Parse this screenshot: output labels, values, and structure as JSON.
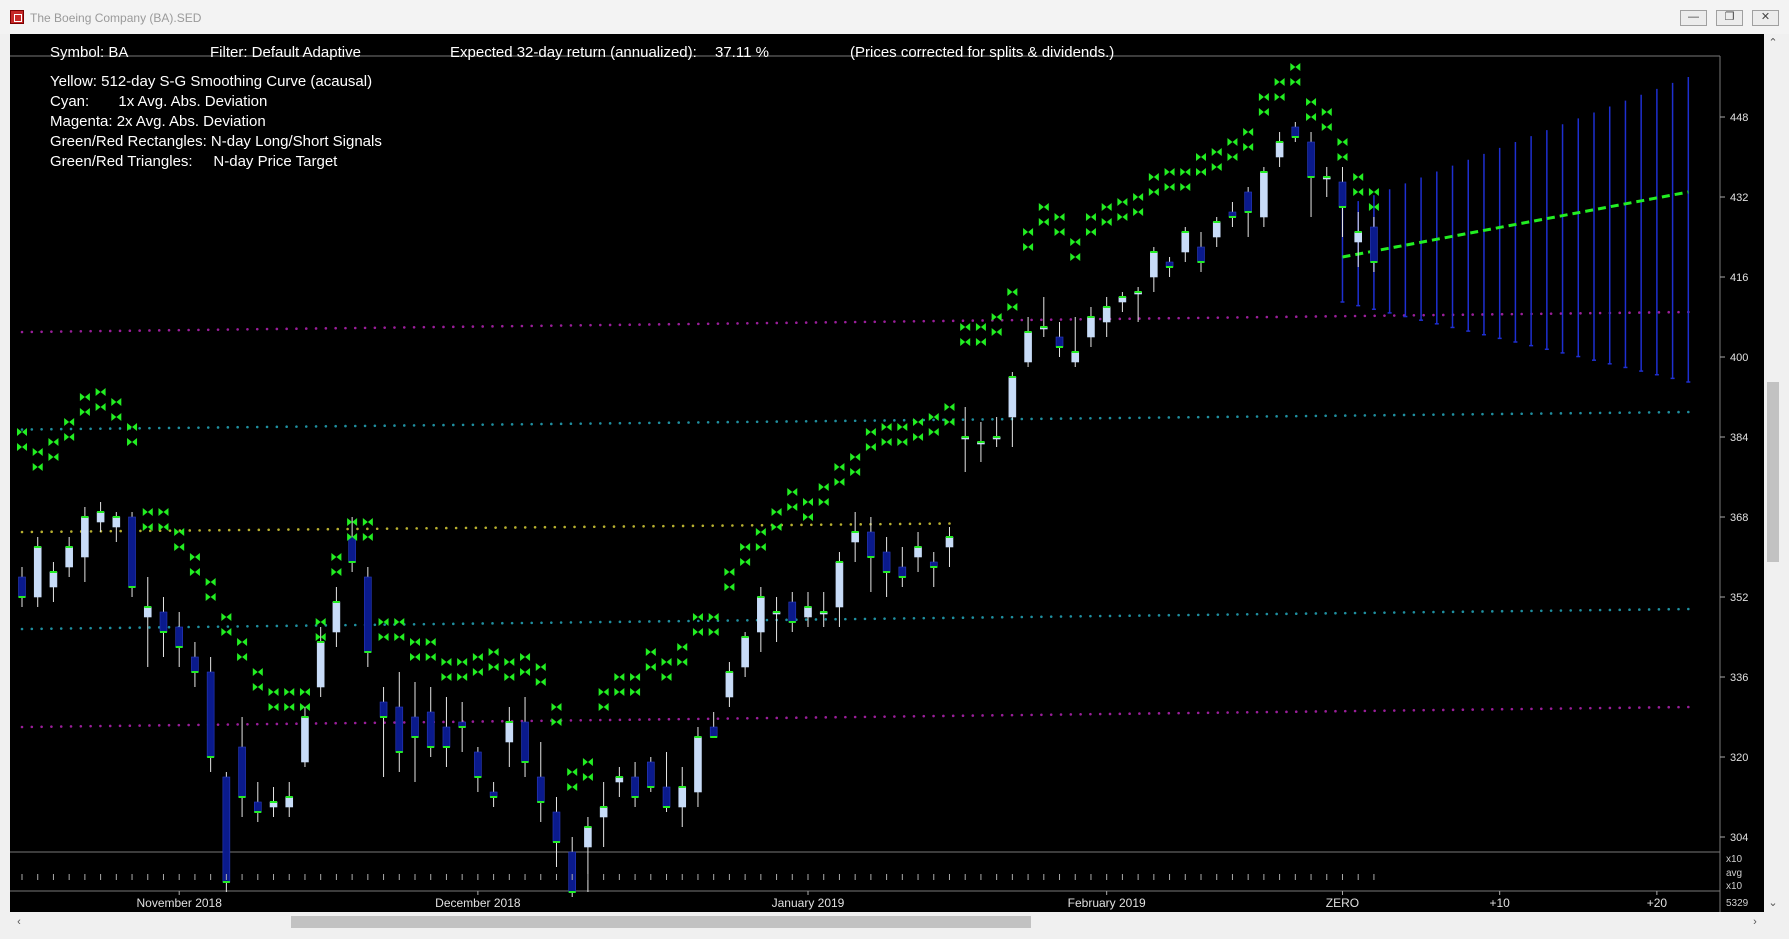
{
  "window": {
    "title": "The Boeing Company (BA).SED",
    "buttons": [
      "minimize",
      "restore",
      "close"
    ]
  },
  "header": {
    "symbol": "Symbol: BA",
    "filter": "Filter: Default Adaptive",
    "expected_label": "Expected 32-day return (annualized):",
    "expected_value": "37.11 %",
    "note": "(Prices corrected for splits & dividends.)"
  },
  "legend": [
    "Yellow: 512-day S-G Smoothing Curve (acausal)",
    "Cyan:       1x Avg. Abs. Deviation",
    "Magenta: 2x Avg. Abs. Deviation",
    "Green/Red Rectangles: N-day Long/Short Signals",
    "Green/Red Triangles:     N-day Price Target"
  ],
  "lower_panel": {
    "labels": [
      "x10",
      "avg",
      "x10"
    ],
    "counter": "5329"
  },
  "colors": {
    "background": "#000000",
    "candle_up": "#c8dcf8",
    "candle_down": "#0a1a8c",
    "signal": "#22ee22",
    "smooth_curve": "#b8b030",
    "dev1": "#1f8fa0",
    "dev2": "#9a1e9a",
    "forecast_band": "#1e2fd0",
    "forecast_line": "#22ee22"
  },
  "chart_data": {
    "type": "candlestick",
    "ylim": [
      292,
      454
    ],
    "y_ticks": [
      448,
      432,
      416,
      400,
      384,
      368,
      352,
      336,
      320,
      304
    ],
    "x_labels": [
      {
        "label": "November 2018",
        "slot": 10
      },
      {
        "label": "December 2018",
        "slot": 29
      },
      {
        "label": "January 2019",
        "slot": 50
      },
      {
        "label": "February 2019",
        "slot": 69
      },
      {
        "label": "ZERO",
        "slot": 84
      },
      {
        "label": "+10",
        "slot": 94
      },
      {
        "label": "+20",
        "slot": 104
      }
    ],
    "candles": [
      [
        356,
        352,
        358,
        350
      ],
      [
        352,
        362,
        364,
        350
      ],
      [
        354,
        357,
        359,
        351
      ],
      [
        358,
        362,
        364,
        356
      ],
      [
        360,
        368,
        370,
        355
      ],
      [
        367,
        369,
        371,
        365
      ],
      [
        366,
        368,
        369,
        363
      ],
      [
        368,
        354,
        369,
        352
      ],
      [
        348,
        350,
        356,
        338
      ],
      [
        349,
        345,
        352,
        340
      ],
      [
        346,
        342,
        349,
        338
      ],
      [
        340,
        337,
        343,
        334
      ],
      [
        337,
        320,
        340,
        317
      ],
      [
        316,
        295,
        317,
        293
      ],
      [
        322,
        312,
        328,
        308
      ],
      [
        311,
        309,
        315,
        307
      ],
      [
        310,
        311,
        314,
        308
      ],
      [
        310,
        312,
        315,
        308
      ],
      [
        319,
        328,
        330,
        318
      ],
      [
        334,
        343,
        346,
        332
      ],
      [
        345,
        351,
        354,
        342
      ],
      [
        364,
        359,
        368,
        357
      ],
      [
        356,
        341,
        358,
        338
      ],
      [
        331,
        328,
        334,
        316
      ],
      [
        330,
        321,
        337,
        317
      ],
      [
        328,
        324,
        335,
        315
      ],
      [
        329,
        322,
        334,
        320
      ],
      [
        326,
        322,
        332,
        318
      ],
      [
        327,
        326,
        331,
        321
      ],
      [
        321,
        316,
        322,
        313
      ],
      [
        313,
        312,
        315,
        310
      ],
      [
        323,
        327,
        330,
        318
      ],
      [
        327,
        319,
        332,
        316
      ],
      [
        316,
        311,
        323,
        307
      ],
      [
        309,
        303,
        312,
        298
      ],
      [
        301,
        293,
        304,
        292
      ],
      [
        302,
        306,
        308,
        293
      ],
      [
        308,
        310,
        315,
        302
      ],
      [
        315,
        316,
        318,
        312
      ],
      [
        316,
        312,
        319,
        310
      ],
      [
        319,
        314,
        320,
        313
      ],
      [
        314,
        310,
        321,
        309
      ],
      [
        310,
        314,
        318,
        306
      ],
      [
        313,
        324,
        326,
        310
      ],
      [
        326,
        324,
        329,
        324
      ],
      [
        332,
        337,
        339,
        330
      ],
      [
        338,
        344,
        345,
        336
      ],
      [
        345,
        352,
        354,
        341
      ],
      [
        349,
        349,
        352,
        343
      ],
      [
        351,
        347,
        353,
        345
      ],
      [
        348,
        350,
        353,
        346
      ],
      [
        349,
        349,
        353,
        346
      ],
      [
        350,
        359,
        361,
        346
      ],
      [
        363,
        365,
        369,
        359
      ],
      [
        365,
        360,
        368,
        353
      ],
      [
        361,
        357,
        364,
        352
      ],
      [
        358,
        356,
        362,
        354
      ],
      [
        360,
        362,
        365,
        357
      ],
      [
        359,
        358,
        361,
        354
      ],
      [
        362,
        364,
        366,
        358
      ],
      [
        384,
        384,
        390,
        377
      ],
      [
        383,
        383,
        387,
        379
      ],
      [
        384,
        384,
        388,
        382
      ],
      [
        388,
        396,
        397,
        382
      ],
      [
        399,
        405,
        408,
        398
      ],
      [
        406,
        406,
        412,
        404
      ],
      [
        404,
        402,
        407,
        400
      ],
      [
        399,
        401,
        408,
        398
      ],
      [
        404,
        408,
        410,
        402
      ],
      [
        407,
        410,
        412,
        404
      ],
      [
        411,
        412,
        413,
        409
      ],
      [
        413,
        413,
        414,
        407
      ],
      [
        416,
        421,
        422,
        413
      ],
      [
        419,
        418,
        420,
        416
      ],
      [
        421,
        425,
        426,
        419
      ],
      [
        422,
        419,
        425,
        417
      ],
      [
        424,
        427,
        428,
        422
      ],
      [
        429,
        428,
        431,
        426
      ],
      [
        433,
        429,
        434,
        424
      ],
      [
        428,
        437,
        438,
        426
      ],
      [
        440,
        443,
        445,
        438
      ],
      [
        446,
        444,
        447,
        443
      ],
      [
        443,
        436,
        445,
        428
      ],
      [
        436,
        436,
        438,
        432
      ],
      [
        435,
        430,
        438,
        424
      ],
      [
        423,
        425,
        429,
        418
      ],
      [
        426,
        419,
        428,
        417
      ]
    ],
    "signals": [
      [
        382,
        385
      ],
      [
        378,
        381
      ],
      [
        380,
        383
      ],
      [
        384,
        387
      ],
      [
        389,
        392
      ],
      [
        390,
        393
      ],
      [
        388,
        391
      ],
      [
        383,
        386
      ],
      [
        366,
        369
      ],
      [
        366,
        369
      ],
      [
        362,
        365
      ],
      [
        357,
        360
      ],
      [
        352,
        355
      ],
      [
        345,
        348
      ],
      [
        340,
        343
      ],
      [
        334,
        337
      ],
      [
        330,
        333
      ],
      [
        330,
        333
      ],
      [
        330,
        333
      ],
      [
        344,
        347
      ],
      [
        357,
        360
      ],
      [
        364,
        367
      ],
      [
        364,
        367
      ],
      [
        344,
        347
      ],
      [
        344,
        347
      ],
      [
        340,
        343
      ],
      [
        340,
        343
      ],
      [
        336,
        339
      ],
      [
        336,
        339
      ],
      [
        337,
        340
      ],
      [
        338,
        341
      ],
      [
        336,
        339
      ],
      [
        337,
        340
      ],
      [
        335,
        338
      ],
      [
        327,
        330
      ],
      [
        314,
        317
      ],
      [
        316,
        319
      ],
      [
        330,
        333
      ],
      [
        333,
        336
      ],
      [
        333,
        336
      ],
      [
        338,
        341
      ],
      [
        336,
        339
      ],
      [
        339,
        342
      ],
      [
        345,
        348
      ],
      [
        345,
        348
      ],
      [
        354,
        357
      ],
      [
        359,
        362
      ],
      [
        362,
        365
      ],
      [
        366,
        369
      ],
      [
        370,
        373
      ],
      [
        368,
        371
      ],
      [
        371,
        374
      ],
      [
        375,
        378
      ],
      [
        377,
        380
      ],
      [
        382,
        385
      ],
      [
        383,
        386
      ],
      [
        383,
        386
      ],
      [
        384,
        387
      ],
      [
        385,
        388
      ],
      [
        387,
        390
      ],
      [
        403,
        406
      ],
      [
        403,
        406
      ],
      [
        405,
        408
      ],
      [
        410,
        413
      ],
      [
        422,
        425
      ],
      [
        427,
        430
      ],
      [
        425,
        428
      ],
      [
        420,
        423
      ],
      [
        425,
        428
      ],
      [
        427,
        430
      ],
      [
        428,
        431
      ],
      [
        429,
        432
      ],
      [
        433,
        436
      ],
      [
        434,
        437
      ],
      [
        434,
        437
      ],
      [
        437,
        440
      ],
      [
        438,
        441
      ],
      [
        440,
        443
      ],
      [
        442,
        445
      ],
      [
        449,
        452
      ],
      [
        452,
        455
      ],
      [
        455,
        458
      ],
      [
        448,
        451
      ],
      [
        446,
        449
      ],
      [
        440,
        443
      ],
      [
        433,
        436
      ],
      [
        430,
        433
      ]
    ],
    "curves": {
      "smooth": {
        "x": [
          0,
          59
        ],
        "y": [
          365.0,
          366.7
        ]
      },
      "dev1_upper": {
        "x": [
          0,
          106
        ],
        "y": [
          385.5,
          389.0
        ]
      },
      "dev1_lower": {
        "x": [
          0,
          106
        ],
        "y": [
          345.6,
          349.6
        ]
      },
      "dev2_upper": {
        "x": [
          0,
          106
        ],
        "y": [
          405.0,
          409.0
        ]
      },
      "dev2_lower": {
        "x": [
          0,
          106
        ],
        "y": [
          326.0,
          330.0
        ]
      }
    },
    "forecast": {
      "x": [
        84,
        106
      ],
      "y": [
        420.0,
        433.0
      ],
      "upper": [
        430.0,
        456.0
      ],
      "lower": [
        411.0,
        395.0
      ]
    }
  }
}
